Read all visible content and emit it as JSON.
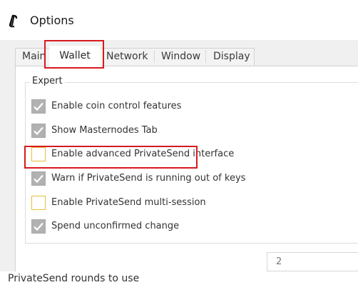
{
  "window": {
    "title": "Options",
    "title_icon": "dash-logo-icon"
  },
  "tabs": [
    {
      "label": "Main",
      "selected": false
    },
    {
      "label": "Wallet",
      "selected": true
    },
    {
      "label": "Network",
      "selected": false
    },
    {
      "label": "Window",
      "selected": false
    },
    {
      "label": "Display",
      "selected": false
    }
  ],
  "expert": {
    "title": "Expert",
    "options": [
      {
        "label": "Enable coin control features",
        "checked": true
      },
      {
        "label": "Show Masternodes Tab",
        "checked": true
      },
      {
        "label": "Enable advanced PrivateSend interface",
        "checked": false
      },
      {
        "label": "Warn if PrivateSend is running out of keys",
        "checked": true
      },
      {
        "label": "Enable PrivateSend multi-session",
        "checked": false
      },
      {
        "label": "Spend unconfirmed change",
        "checked": true
      }
    ]
  },
  "privatesend": {
    "rounds_label": "PrivateSend rounds to use",
    "rounds_value": "2"
  },
  "colors": {
    "highlight": "#d61a1f",
    "checkbox_checked": "#b1b1b1",
    "checkbox_unchecked_border": "#e8bd3c"
  }
}
